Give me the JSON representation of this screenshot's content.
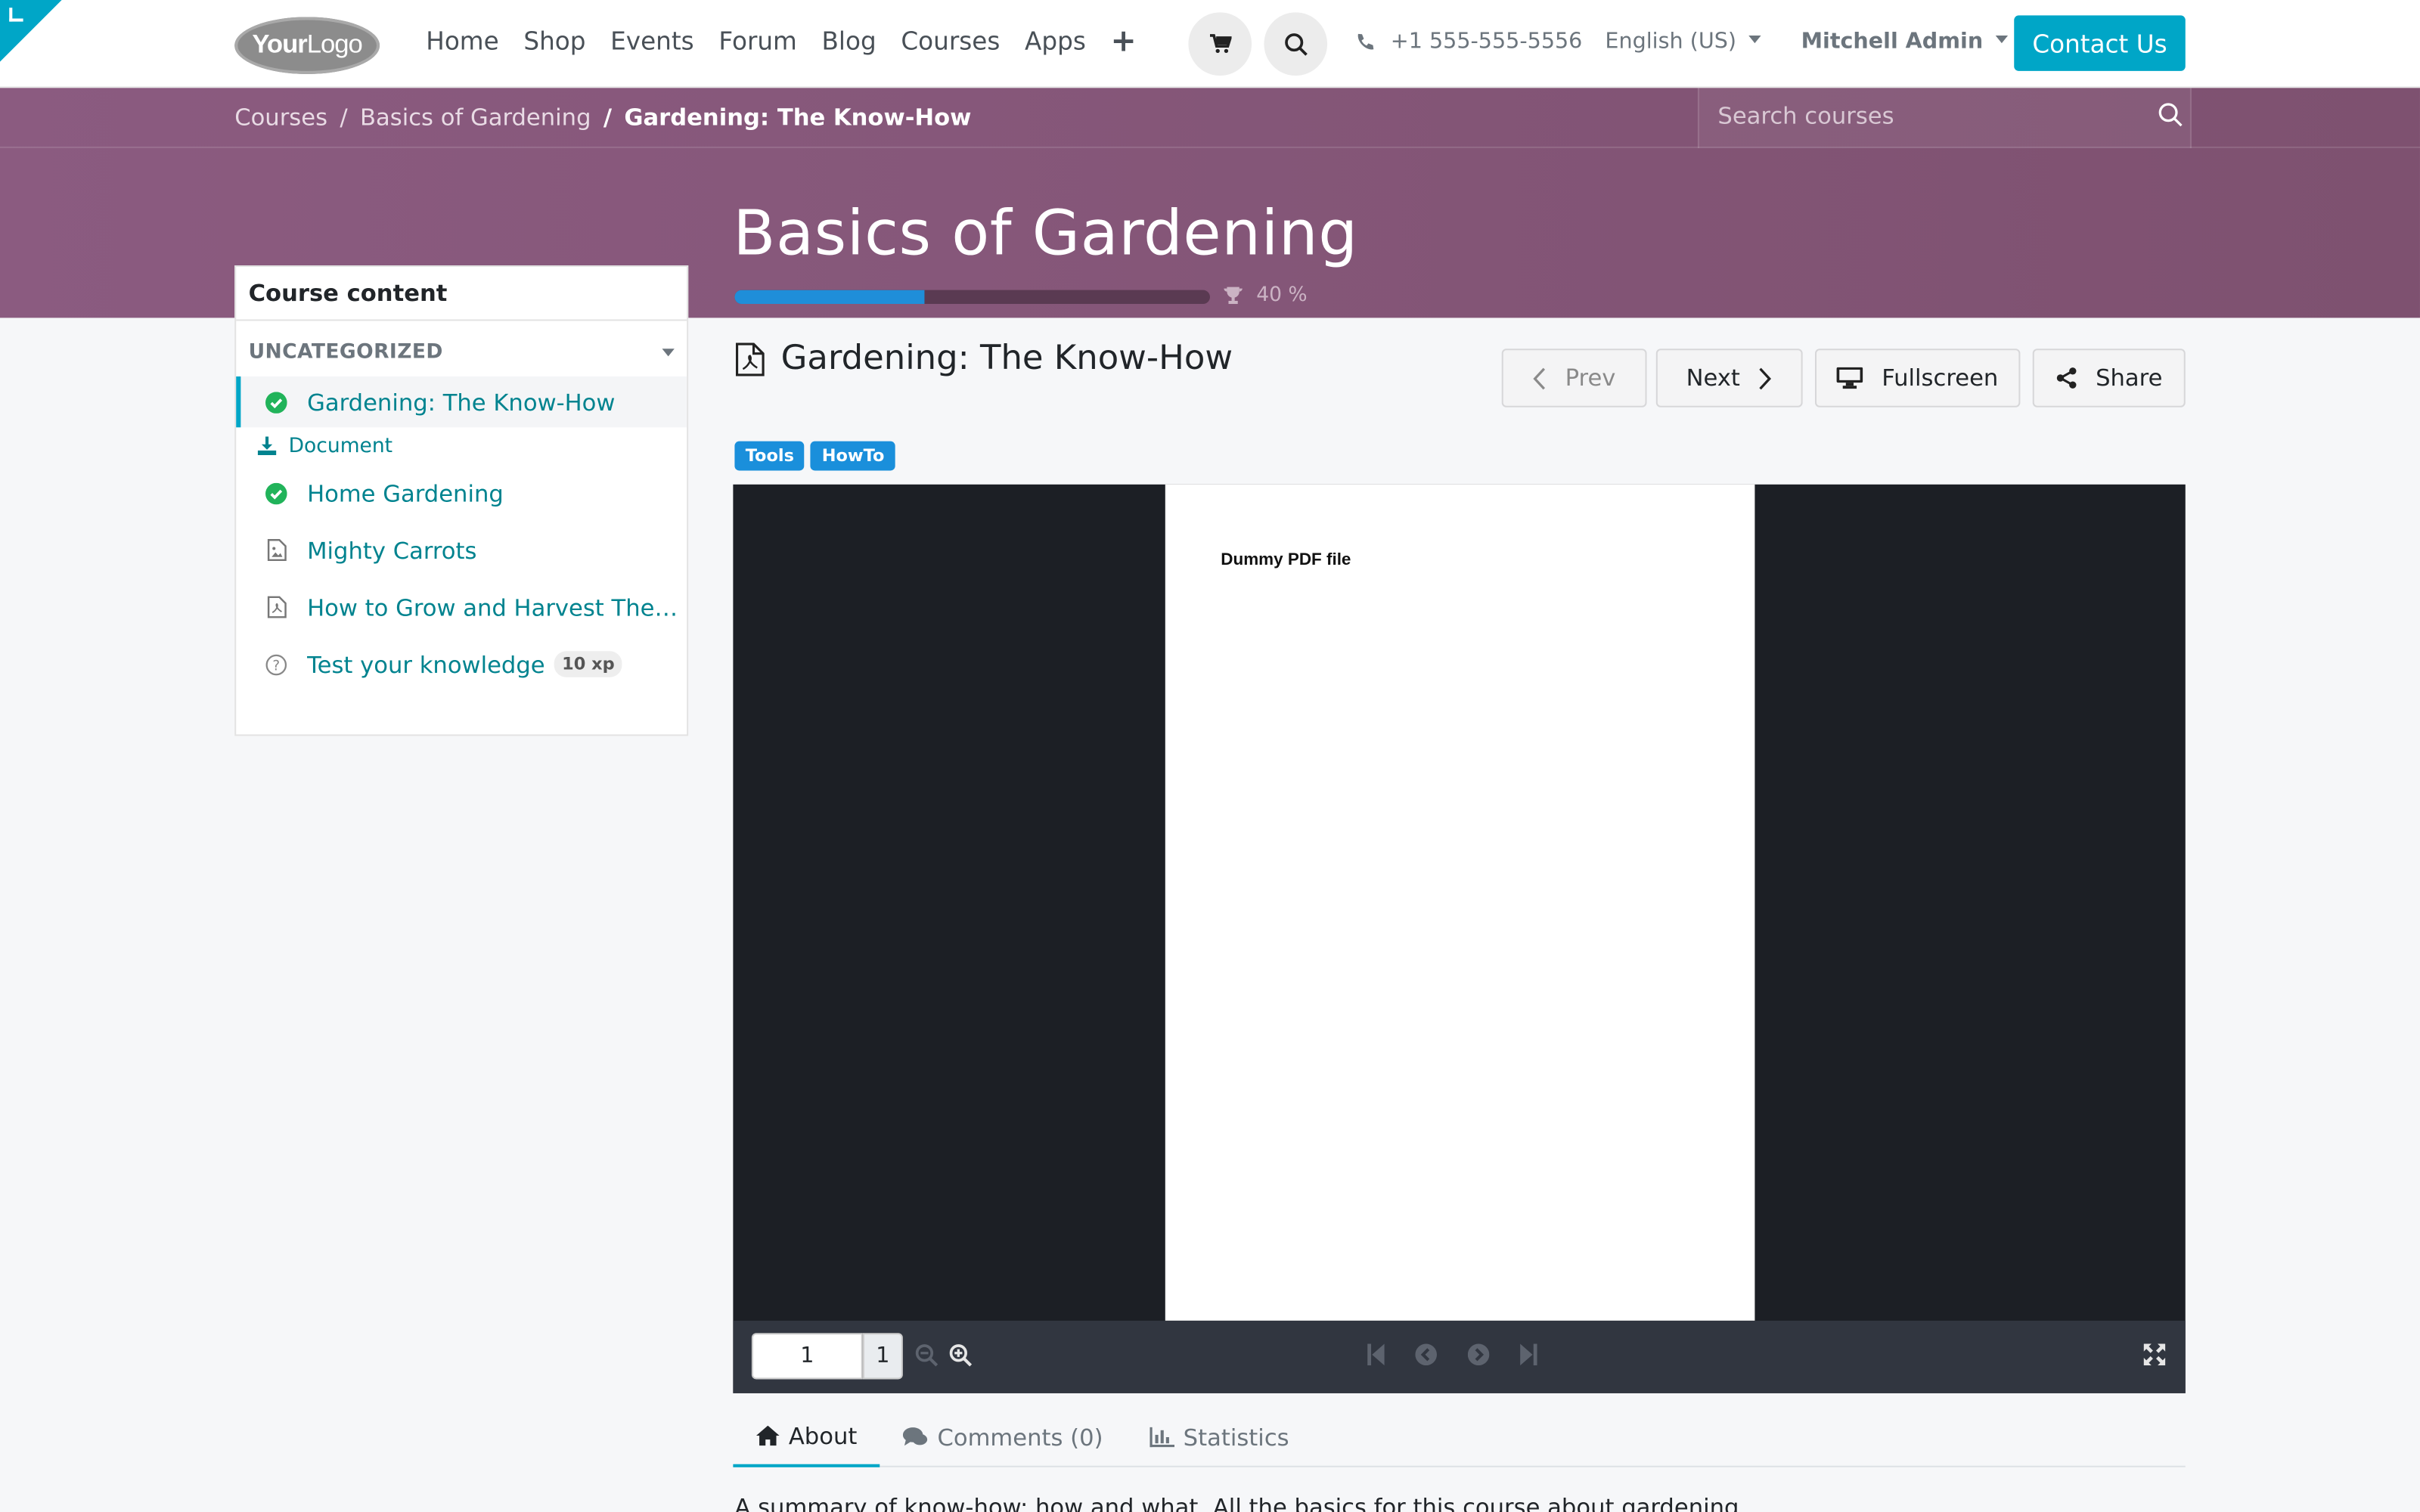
{
  "header": {
    "logo_a": "Your",
    "logo_b": "Logo",
    "nav": [
      "Home",
      "Shop",
      "Events",
      "Forum",
      "Blog",
      "Courses",
      "Apps"
    ],
    "phone": "+1 555-555-5556",
    "language": "English (US)",
    "user": "Mitchell Admin",
    "contact": "Contact Us"
  },
  "breadcrumb": {
    "root": "Courses",
    "course": "Basics of Gardening",
    "current": "Gardening: The Know-How"
  },
  "search": {
    "placeholder": "Search courses"
  },
  "course": {
    "title": "Basics of Gardening",
    "progress_label": "40 %",
    "progress": 0.4
  },
  "sidebar": {
    "heading": "Course content",
    "section": "UNCATEGORIZED",
    "items": [
      {
        "label": "Gardening: The Know-How",
        "icon": "check-circle-icon",
        "active": true
      },
      {
        "label": "Document",
        "icon": "download-icon",
        "sub": true
      },
      {
        "label": "Home Gardening",
        "icon": "check-circle-icon"
      },
      {
        "label": "Mighty Carrots",
        "icon": "image-file-icon"
      },
      {
        "label": "How to Grow and Harvest The B…",
        "icon": "pdf-file-icon"
      },
      {
        "label": "Test your knowledge",
        "icon": "question-icon",
        "badge": "10 xp"
      }
    ]
  },
  "lesson": {
    "title": "Gardening: The Know-How",
    "prev": "Prev",
    "next": "Next",
    "fullscreen": "Fullscreen",
    "share": "Share",
    "tags": [
      "Tools",
      "HowTo"
    ]
  },
  "viewer": {
    "page_text": "Dummy PDF file",
    "page": "1",
    "total": "1"
  },
  "tabs": [
    {
      "label": "About",
      "icon": "home-icon"
    },
    {
      "label": "Comments (0)",
      "icon": "comments-icon"
    },
    {
      "label": "Statistics",
      "icon": "bar-chart-icon"
    }
  ],
  "about": {
    "summary": "A summary of know-how: how and what. All the basics for this course about gardening."
  },
  "colors": {
    "accent": "#00a6c7",
    "band": "#83566f",
    "link": "#00838f",
    "tag": "#1a8fdb",
    "success": "#21b35a"
  }
}
